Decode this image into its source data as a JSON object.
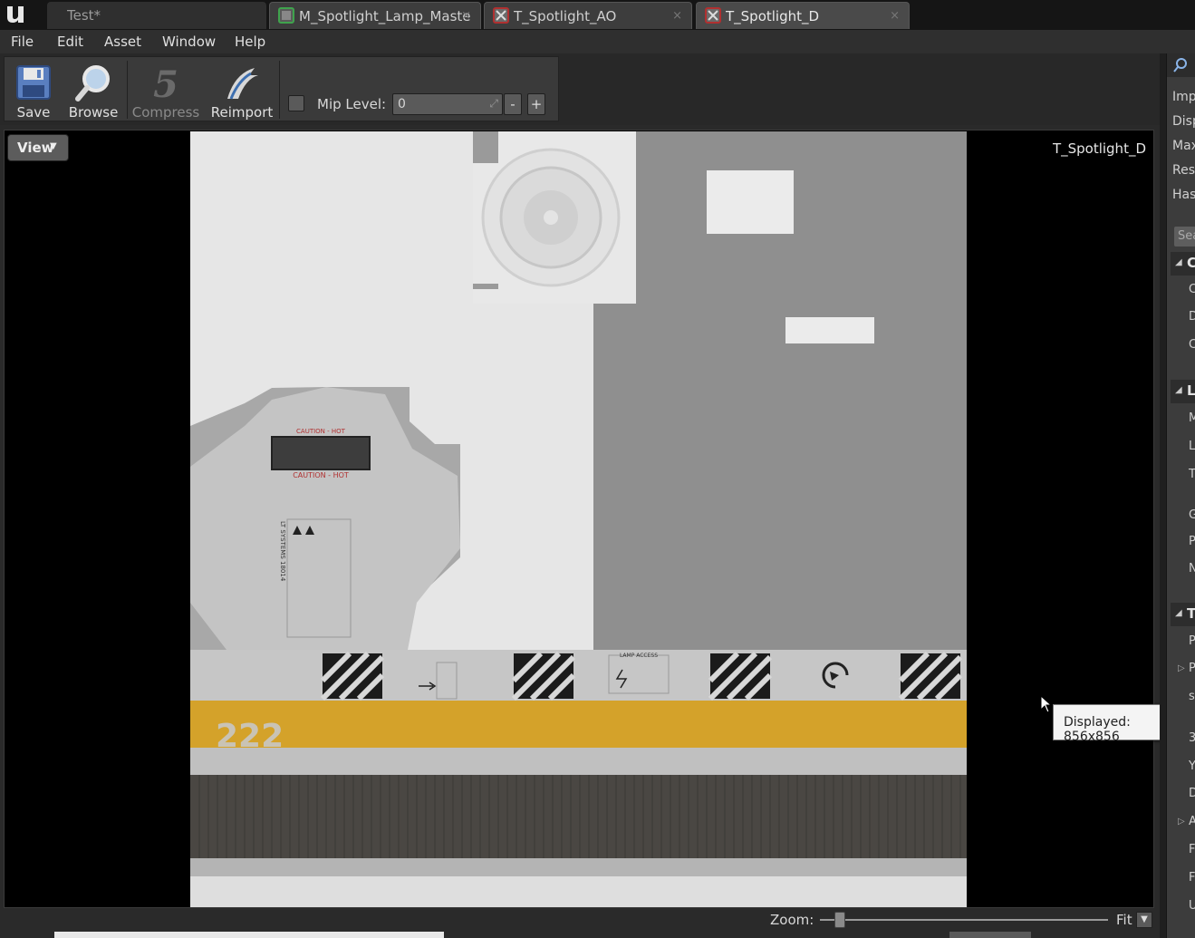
{
  "tabs": [
    {
      "label": "Test*",
      "active": false
    },
    {
      "label": "M_Spotlight_Lamp_Maste",
      "icon": "material-icon",
      "active": false
    },
    {
      "label": "T_Spotlight_AO",
      "icon": "texture-icon",
      "active": false
    },
    {
      "label": "T_Spotlight_D",
      "icon": "texture-icon",
      "active": true
    }
  ],
  "menu": [
    "File",
    "Edit",
    "Asset",
    "Window",
    "Help"
  ],
  "toolbar": {
    "save": "Save",
    "browse": "Browse",
    "compress": "Compress",
    "reimport": "Reimport",
    "mip_label": "Mip Level:",
    "mip_value": "0",
    "mip_minus": "-",
    "mip_plus": "+"
  },
  "viewport": {
    "view_button": "View",
    "asset_name": "T_Spotlight_D"
  },
  "texture": {
    "caution_top": "CAUTION - HOT",
    "caution_bottom": "CAUTION - HOT",
    "systems_text": "LT SYSTEMS 18014",
    "lamp_access": "LAMP ACCESS",
    "number": "222",
    "accent_yellow": "#d4a22a"
  },
  "tooltip": "Displayed: 856x856",
  "statusbar": {
    "zoom_label": "Zoom:",
    "zoom_fit": "Fit"
  },
  "details": {
    "rows": [
      "Imp",
      "Disp",
      "Max",
      "Res",
      "Has"
    ],
    "search_placeholder": "Sea",
    "categories": [
      {
        "label": "C",
        "props": [
          "C",
          "D",
          "C"
        ]
      },
      {
        "label": "L",
        "props": [
          "M",
          "L",
          "T",
          "G",
          "P",
          "N"
        ]
      },
      {
        "label": "T",
        "props": [
          "P",
          "P",
          "s",
          "3",
          "Y",
          "D",
          "A",
          "F",
          "F",
          "U"
        ]
      }
    ]
  }
}
